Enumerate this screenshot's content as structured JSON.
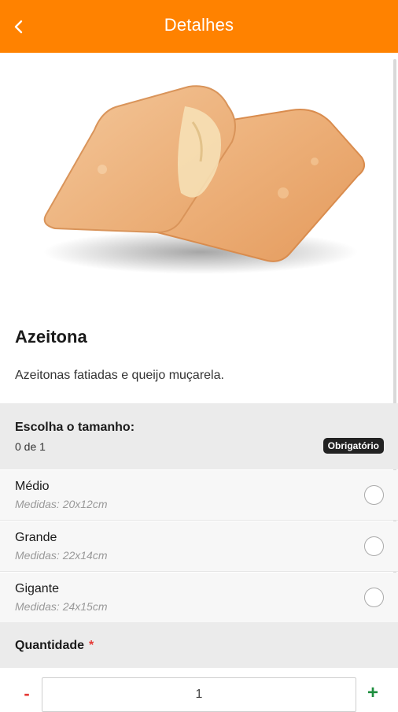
{
  "header": {
    "title": "Detalhes",
    "back_icon": "chevron-left-icon",
    "color": "#FF8200"
  },
  "product": {
    "name": "Azeitona",
    "description": "Azeitonas fatiadas e queijo muçarela."
  },
  "size_group": {
    "title": "Escolha o tamanho:",
    "count": "0 de 1",
    "badge": "Obrigatório",
    "options": [
      {
        "name": "Médio",
        "measure": "Medidas: 20x12cm",
        "selected": false
      },
      {
        "name": "Grande",
        "measure": "Medidas: 22x14cm",
        "selected": false
      },
      {
        "name": "Gigante",
        "measure": "Medidas: 24x15cm",
        "selected": false
      }
    ]
  },
  "quantity": {
    "title": "Quantidade",
    "required_mark": "*",
    "minus_label": "-",
    "plus_label": "+",
    "value": "1"
  }
}
